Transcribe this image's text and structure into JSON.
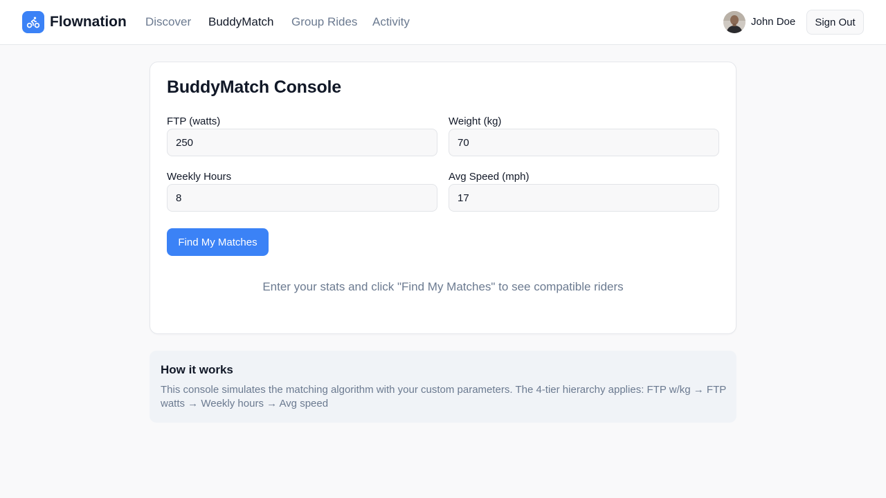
{
  "app": {
    "brand": "Flownation",
    "logo_icon": "bicycle-icon"
  },
  "nav": {
    "items": [
      {
        "label": "Discover",
        "active": false
      },
      {
        "label": "BuddyMatch",
        "active": true
      },
      {
        "label": "Group Rides",
        "active": false
      },
      {
        "label": "Activity",
        "active": false
      }
    ]
  },
  "user": {
    "name": "John Doe",
    "signout_label": "Sign Out"
  },
  "console": {
    "title": "BuddyMatch Console",
    "fields": [
      {
        "label": "FTP (watts)",
        "value": "250"
      },
      {
        "label": "Weight (kg)",
        "value": "70"
      },
      {
        "label": "Weekly Hours",
        "value": "8"
      },
      {
        "label": "Avg Speed (mph)",
        "value": "17"
      }
    ],
    "button_label": "Find My Matches",
    "hint": "Enter your stats and click \"Find My Matches\" to see compatible riders"
  },
  "how_it_works": {
    "title": "How it works",
    "text": "This console simulates the matching algorithm with your custom parameters. The 4-tier hierarchy applies: FTP w/kg → FTP watts → Weekly hours → Avg speed"
  },
  "colors": {
    "accent": "#3b82f6",
    "text_primary": "#111827",
    "text_muted": "#6b7a90",
    "page_bg": "#f9f9fa"
  }
}
